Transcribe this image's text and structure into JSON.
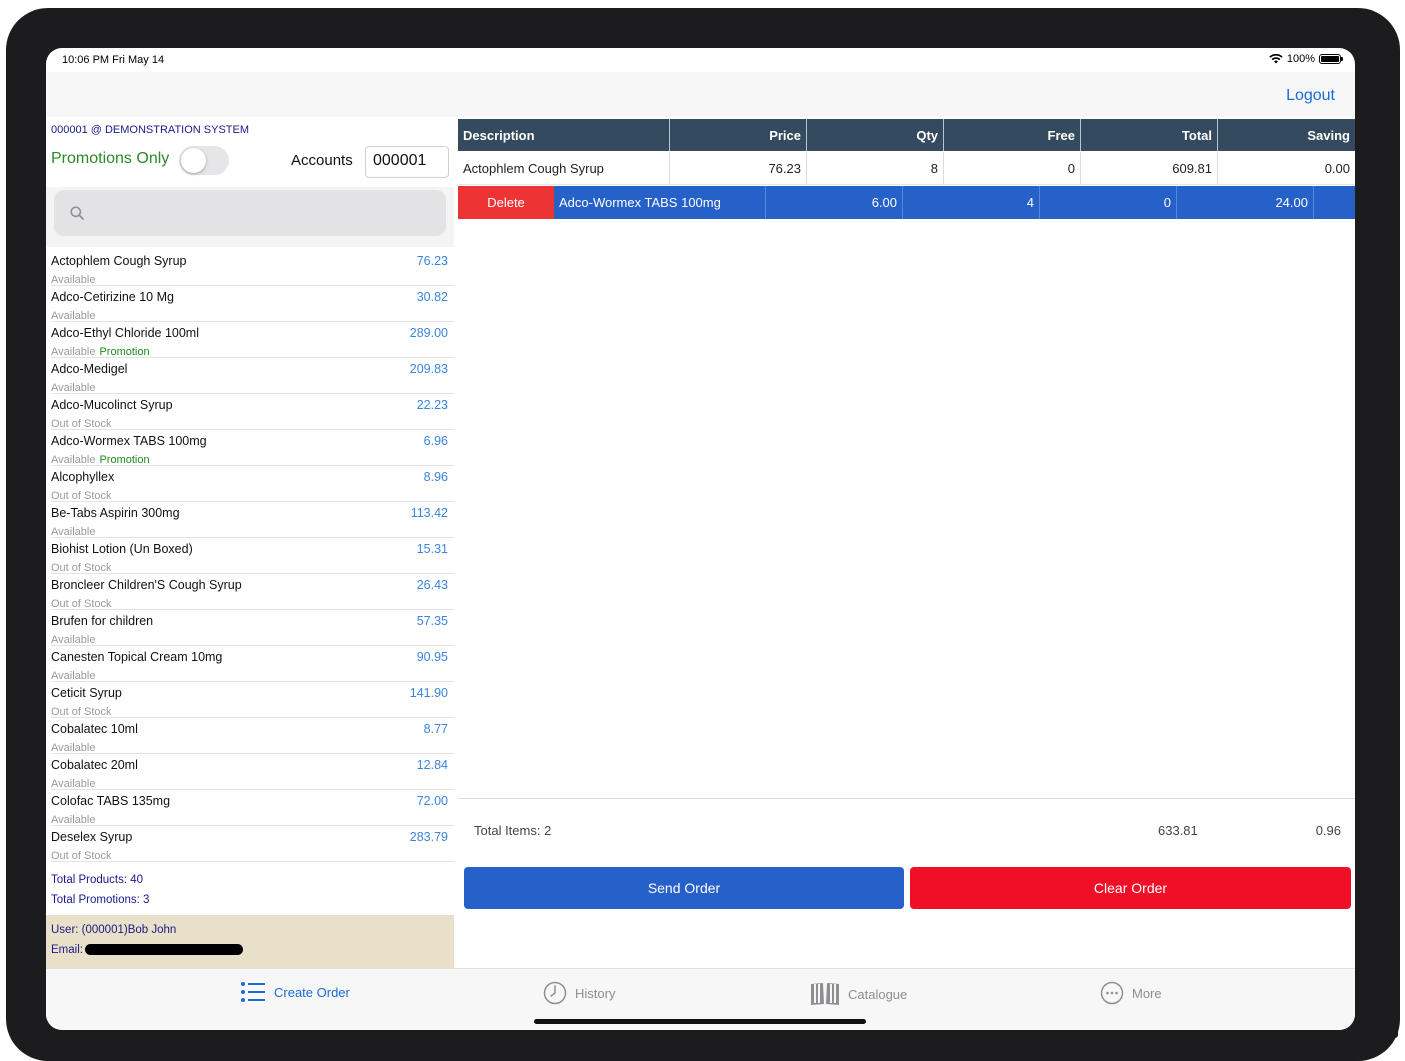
{
  "status": {
    "time": "10:06 PM  Fri May 14",
    "battery": "100%"
  },
  "nav": {
    "logout_label": "Logout"
  },
  "left": {
    "system_title": "000001 @ DEMONSTRATION SYSTEM",
    "promotions_label": "Promotions Only",
    "promotions_on": false,
    "accounts_label": "Accounts",
    "accounts_value": "000001",
    "search_placeholder": "",
    "products": [
      {
        "name": "Actophlem Cough Syrup",
        "price": "76.23",
        "status": "Available",
        "promo": ""
      },
      {
        "name": "Adco-Cetirizine 10 Mg",
        "price": "30.82",
        "status": "Available",
        "promo": ""
      },
      {
        "name": "Adco-Ethyl Chloride 100ml",
        "price": "289.00",
        "status": "Available",
        "promo": "Promotion"
      },
      {
        "name": "Adco-Medigel",
        "price": "209.83",
        "status": "Available",
        "promo": ""
      },
      {
        "name": "Adco-Mucolinct Syrup",
        "price": "22.23",
        "status": "Out of Stock",
        "promo": ""
      },
      {
        "name": "Adco-Wormex TABS 100mg",
        "price": "6.96",
        "status": "Available",
        "promo": "Promotion"
      },
      {
        "name": "Alcophyllex",
        "price": "8.96",
        "status": "Out of Stock",
        "promo": ""
      },
      {
        "name": "Be-Tabs Aspirin 300mg",
        "price": "113.42",
        "status": "Available",
        "promo": ""
      },
      {
        "name": "Biohist Lotion  (Un Boxed)",
        "price": "15.31",
        "status": "Out of Stock",
        "promo": ""
      },
      {
        "name": "Broncleer Children'S Cough Syrup",
        "price": "26.43",
        "status": "Out of Stock",
        "promo": ""
      },
      {
        "name": "Brufen for children",
        "price": "57.35",
        "status": "Available",
        "promo": ""
      },
      {
        "name": "Canesten Topical Cream 10mg",
        "price": "90.95",
        "status": "Available",
        "promo": ""
      },
      {
        "name": "Ceticit Syrup",
        "price": "141.90",
        "status": "Out of Stock",
        "promo": ""
      },
      {
        "name": "Cobalatec 10ml",
        "price": "8.77",
        "status": "Available",
        "promo": ""
      },
      {
        "name": "Cobalatec 20ml",
        "price": "12.84",
        "status": "Available",
        "promo": ""
      },
      {
        "name": "Colofac TABS 135mg",
        "price": "72.00",
        "status": "Available",
        "promo": ""
      },
      {
        "name": "Deselex Syrup",
        "price": "283.79",
        "status": "Out of Stock",
        "promo": ""
      }
    ],
    "total_products": "Total Products: 40",
    "total_promotions": "Total Promotions: 3",
    "user_line": "User: (000001)Bob John",
    "email_label": "Email:"
  },
  "order": {
    "columns": [
      "Description",
      "Price",
      "Qty",
      "Free",
      "Total",
      "Saving"
    ],
    "rows": [
      {
        "description": "Actophlem Cough Syrup",
        "price": "76.23",
        "qty": "8",
        "free": "0",
        "total": "609.81",
        "saving": "0.00"
      },
      {
        "description": "Adco-Wormex TABS 100mg",
        "price": "6.00",
        "qty": "4",
        "free": "0",
        "total": "24.00",
        "saving": ""
      }
    ],
    "delete_label": "Delete",
    "total_items": "Total Items: 2",
    "total_amount": "633.81",
    "total_saving": "0.96",
    "send_label": "Send Order",
    "clear_label": "Clear Order"
  },
  "tabs": [
    {
      "label": "Create Order",
      "icon": "list-icon",
      "active": true
    },
    {
      "label": "History",
      "icon": "clock-icon",
      "active": false
    },
    {
      "label": "Catalogue",
      "icon": "book-icon",
      "active": false
    },
    {
      "label": "More",
      "icon": "more-icon",
      "active": false
    }
  ],
  "colors": {
    "accent": "#2660c9",
    "danger": "#ef0f26",
    "header": "#344a5e",
    "promo": "#1d8a1d"
  }
}
